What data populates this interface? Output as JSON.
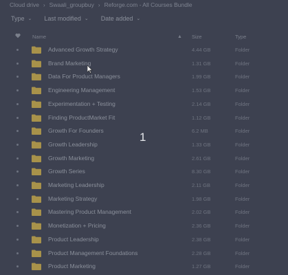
{
  "breadcrumb": [
    "Cloud drive",
    "Swaali_groupbuy",
    "Reforge.com - All Courses Bundle"
  ],
  "filters": {
    "type": "Type",
    "modified": "Last modified",
    "added": "Date added"
  },
  "columns": {
    "name": "Name",
    "size": "Size",
    "type": "Type"
  },
  "rows": [
    {
      "name": "Advanced Growth Strategy",
      "size": "4.44 GB",
      "type": "Folder"
    },
    {
      "name": "Brand Marketing",
      "size": "1.31 GB",
      "type": "Folder"
    },
    {
      "name": "Data For Product Managers",
      "size": "1.99 GB",
      "type": "Folder"
    },
    {
      "name": "Engineering Management",
      "size": "1.53 GB",
      "type": "Folder"
    },
    {
      "name": "Experimentation + Testing",
      "size": "2.14 GB",
      "type": "Folder"
    },
    {
      "name": "Finding ProductMarket Fit",
      "size": "1.12 GB",
      "type": "Folder"
    },
    {
      "name": "Growth For Founders",
      "size": "6.2 MB",
      "type": "Folder"
    },
    {
      "name": "Growth Leadership",
      "size": "1.33 GB",
      "type": "Folder"
    },
    {
      "name": "Growth Marketing",
      "size": "2.61 GB",
      "type": "Folder"
    },
    {
      "name": "Growth Series",
      "size": "8.30 GB",
      "type": "Folder"
    },
    {
      "name": "Marketing Leadership",
      "size": "2.11 GB",
      "type": "Folder"
    },
    {
      "name": "Marketing Strategy",
      "size": "1.98 GB",
      "type": "Folder"
    },
    {
      "name": "Mastering Product Management",
      "size": "2.02 GB",
      "type": "Folder"
    },
    {
      "name": "Monetization + Pricing",
      "size": "2.36 GB",
      "type": "Folder"
    },
    {
      "name": "Product Leadership",
      "size": "2.38 GB",
      "type": "Folder"
    },
    {
      "name": "Product Management Foundations",
      "size": "2.28 GB",
      "type": "Folder"
    },
    {
      "name": "Product Marketing",
      "size": "1.27 GB",
      "type": "Folder"
    }
  ],
  "overlay_number": "1",
  "colors": {
    "background": "#3d4150",
    "folder": "#a8924a"
  }
}
